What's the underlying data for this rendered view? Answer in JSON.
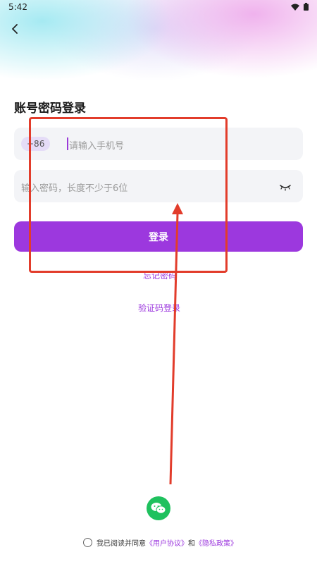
{
  "status_bar": {
    "time": "5:42",
    "wifi_icon": "wifi-icon",
    "battery_icon": "battery-icon"
  },
  "header": {
    "back_icon": "chevron-left-icon"
  },
  "page": {
    "title": "账号密码登录"
  },
  "phone_field": {
    "country_code": "+86",
    "placeholder": "请输入手机号"
  },
  "password_field": {
    "placeholder": "输入密码，长度不少于6位",
    "toggle_icon": "eye-closed-icon"
  },
  "login_button": {
    "label": "登录"
  },
  "links": {
    "forgot_password": "忘记密码",
    "sms_login": "验证码登录"
  },
  "wechat": {
    "icon": "wechat-icon"
  },
  "agreement": {
    "prefix": "我已阅读并同意",
    "user_agreement": "《用户协议》",
    "and": "和",
    "privacy_policy": "《隐私政策》"
  },
  "colors": {
    "accent": "#9c38de",
    "annotation": "#e23c2b",
    "wechat": "#1fc15e"
  }
}
